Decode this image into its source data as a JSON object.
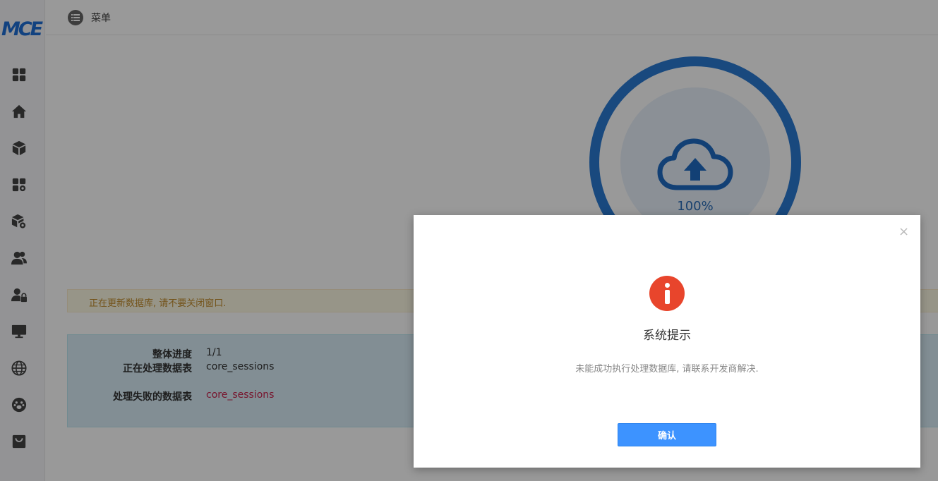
{
  "app": {
    "logo_text": "MCE"
  },
  "sidebar": {
    "items": [
      {
        "name": "dashboard-icon"
      },
      {
        "name": "home-icon"
      },
      {
        "name": "box-icon"
      },
      {
        "name": "apps-settings-icon"
      },
      {
        "name": "package-settings-icon"
      },
      {
        "name": "users-icon"
      },
      {
        "name": "user-lock-icon"
      },
      {
        "name": "monitor-icon"
      },
      {
        "name": "globe-icon"
      },
      {
        "name": "paw-icon"
      },
      {
        "name": "shopping-bag-icon"
      }
    ]
  },
  "topbar": {
    "menu_label": "菜单",
    "menu_icon": "list-icon"
  },
  "progress": {
    "percent_text": "100%",
    "value": 1.0,
    "icon": "cloud-upload-icon",
    "color": "#2b7ad3"
  },
  "notice": {
    "text": "正在更新数据库, 请不要关闭窗口."
  },
  "status": {
    "overall_label": "整体进度",
    "overall_value": "1/1",
    "processing_label": "正在处理数据表",
    "processing_value": "core_sessions",
    "failed_label": "处理失败的数据表",
    "failed_value": "core_sessions"
  },
  "modal": {
    "close_symbol": "×",
    "icon": "info-alert-icon",
    "title": "系统提示",
    "message": "未能成功执行处理数据库, 请联系开发商解决.",
    "confirm_label": "确认",
    "accent_color": "#3d93ff",
    "alert_color": "#e8452c"
  }
}
